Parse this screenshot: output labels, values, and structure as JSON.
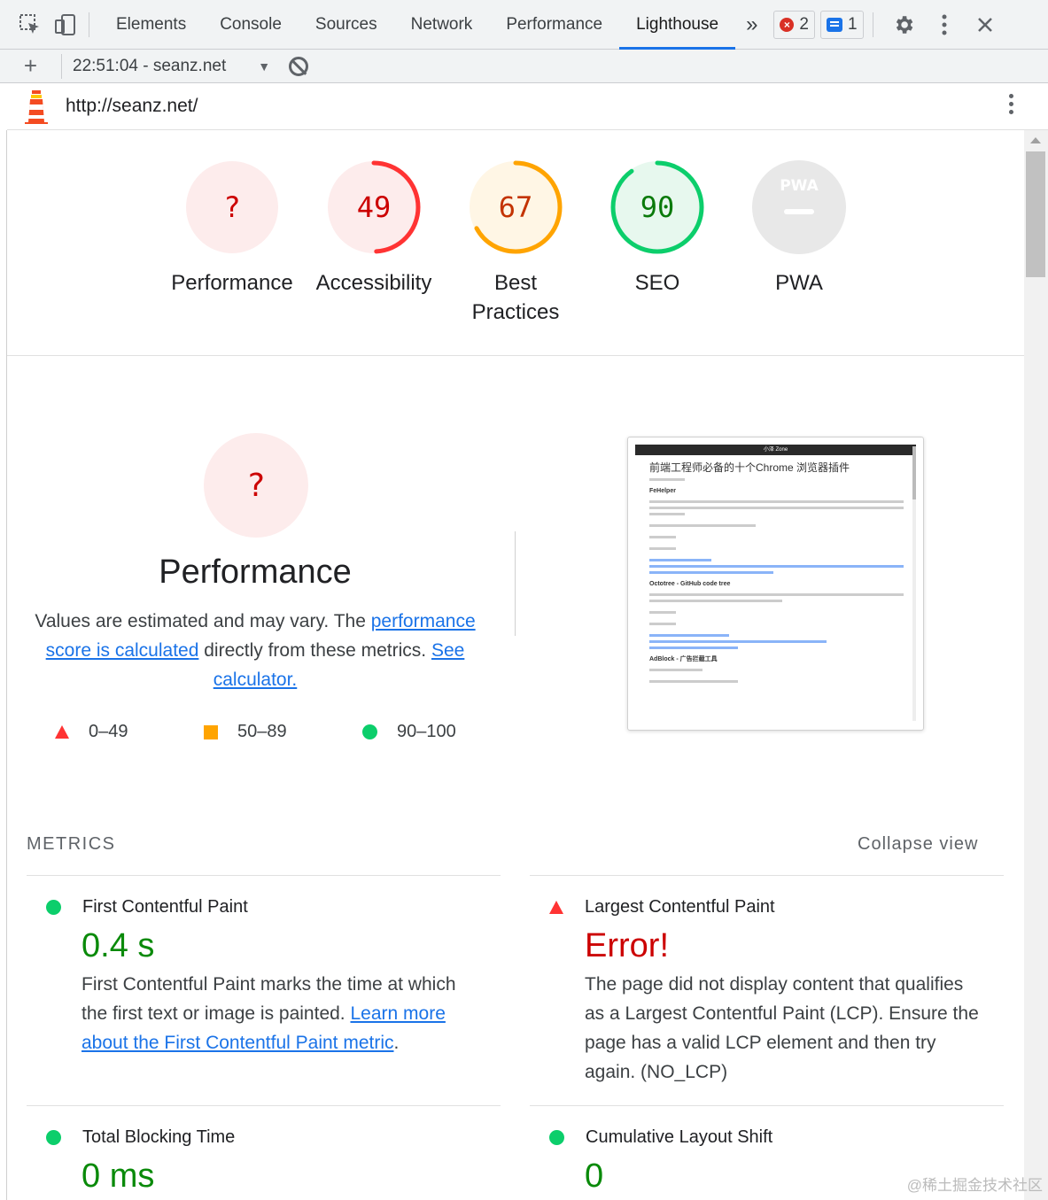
{
  "devtools": {
    "tabs": [
      "Elements",
      "Console",
      "Sources",
      "Network",
      "Performance",
      "Lighthouse"
    ],
    "active_tab": "Lighthouse",
    "more_tabs": "»",
    "error_count": "2",
    "message_count": "1"
  },
  "toolbar": {
    "add": "+",
    "report_label": "22:51:04 - seanz.net",
    "dropdown_arrow": "▼"
  },
  "urlbar": {
    "url": "http://seanz.net/"
  },
  "gauges": [
    {
      "score": "?",
      "label": "Performance",
      "value": null,
      "color": "#ff3333"
    },
    {
      "score": "49",
      "label": "Accessibility",
      "value": 49,
      "color": "#ff3333"
    },
    {
      "score": "67",
      "label_line1": "Best",
      "label_line2": "Practices",
      "value": 67,
      "color": "#ffa400"
    },
    {
      "score": "90",
      "label": "SEO",
      "value": 90,
      "color": "#0cce6b"
    },
    {
      "score": "PWA",
      "label": "PWA",
      "value": null,
      "color": "#cccccc"
    }
  ],
  "performance": {
    "score": "?",
    "title": "Performance",
    "desc_1": "Values are estimated and may vary. The ",
    "link_1": "performance score is calculated",
    "desc_2": " directly from these metrics. ",
    "link_2": "See calculator.",
    "legend": [
      "0–49",
      "50–89",
      "90–100"
    ]
  },
  "screenshot": {
    "site_name": "小泽 Zone",
    "article_title": "前端工程师必备的十个Chrome 浏览器插件",
    "section_1": "FeHelper",
    "section_2": "Octotree - GitHub code tree",
    "section_3": "AdBlock - 广告拦截工具"
  },
  "metrics": {
    "heading": "METRICS",
    "collapse": "Collapse view",
    "fcp": {
      "name": "First Contentful Paint",
      "value": "0.4 s",
      "desc": "First Contentful Paint marks the time at which the first text or image is painted. ",
      "link": "Learn more about the First Contentful Paint metric",
      "end": "."
    },
    "lcp": {
      "name": "Largest Contentful Paint",
      "value": "Error!",
      "desc": "The page did not display content that qualifies as a Largest Contentful Paint (LCP). Ensure the page has a valid LCP element and then try again. (NO_LCP)"
    },
    "tbt": {
      "name": "Total Blocking Time",
      "value": "0 ms"
    },
    "cls": {
      "name": "Cumulative Layout Shift",
      "value": "0"
    }
  },
  "watermark": "@稀土掘金技术社区"
}
